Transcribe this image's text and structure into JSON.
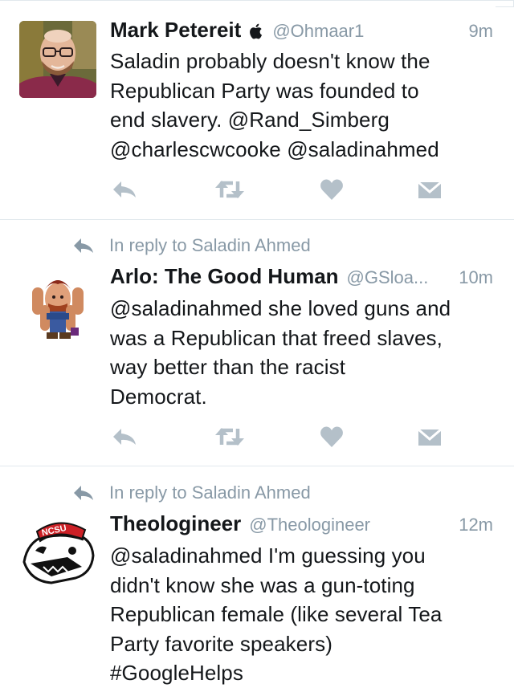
{
  "colors": {
    "text": "#14171a",
    "secondary": "#8899a6",
    "action_icons": "#b4c0c9",
    "divider": "#e1e8ed"
  },
  "tweets": [
    {
      "name": "Mark Petereit",
      "verified_badge": "apple-icon",
      "handle": "@Ohmaar1",
      "time": "9m",
      "lines": [
        "Saladin probably doesn't know the",
        "Republican Party was founded to",
        "end slavery. @Rand_Simberg",
        "@charlescwcooke @saladinahmed"
      ]
    },
    {
      "reply_context": "In reply to Saladin Ahmed",
      "name": "Arlo: The Good Human",
      "handle": "@GSloa...",
      "time": "10m",
      "lines": [
        "@saladinahmed she loved guns and",
        "was a Republican that freed slaves,",
        "way better than the racist",
        "Democrat."
      ]
    },
    {
      "reply_context": "In reply to Saladin Ahmed",
      "name": "Theologineer",
      "handle": "@Theologineer",
      "time": "12m",
      "avatar_text": "NCSU",
      "lines": [
        "@saladinahmed I'm guessing you",
        "didn't know she was a gun-toting",
        "Republican female (like several Tea",
        "Party favorite speakers)",
        "#GoogleHelps"
      ]
    }
  ]
}
